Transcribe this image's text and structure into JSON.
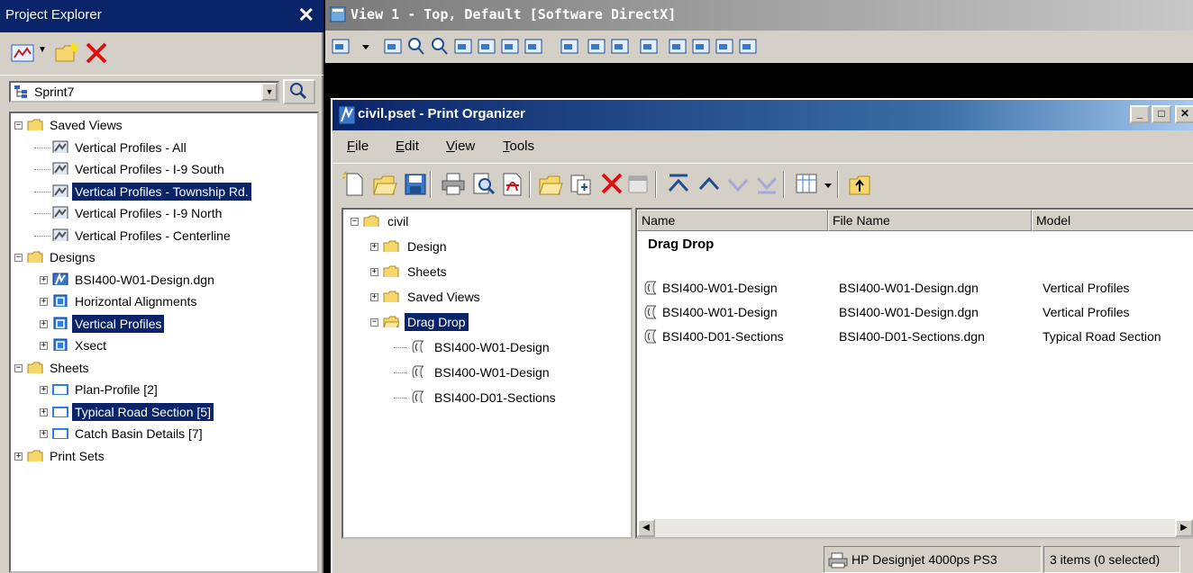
{
  "explorer": {
    "title": "Project Explorer",
    "close_glyph": "✕",
    "combo_value": "Sprint7",
    "tree": [
      {
        "label": "Saved Views",
        "icon": "folder-icon",
        "toggle": "−"
      },
      {
        "label": "Vertical Profiles - All",
        "icon": "saved-view-icon"
      },
      {
        "label": "Vertical Profiles - I-9 South",
        "icon": "saved-view-icon"
      },
      {
        "label": "Vertical Profiles - Township Rd.",
        "icon": "saved-view-icon",
        "selected": true
      },
      {
        "label": "Vertical Profiles - I-9 North",
        "icon": "saved-view-icon"
      },
      {
        "label": "Vertical Profiles - Centerline",
        "icon": "saved-view-icon"
      },
      {
        "label": "Designs",
        "icon": "folder-icon",
        "toggle": "−"
      },
      {
        "label": "BSI400-W01-Design.dgn",
        "icon": "design-file-icon",
        "toggle": "+"
      },
      {
        "label": "Horizontal Alignments",
        "icon": "model-icon",
        "toggle": "+"
      },
      {
        "label": "Vertical Profiles",
        "icon": "model-icon",
        "toggle": "+",
        "selected": true
      },
      {
        "label": "Xsect",
        "icon": "model-icon",
        "toggle": "+"
      },
      {
        "label": "Sheets",
        "icon": "folder-icon",
        "toggle": "−"
      },
      {
        "label": "Plan-Profile [2]",
        "icon": "sheet-icon",
        "toggle": "+"
      },
      {
        "label": "Typical Road Section [5]",
        "icon": "sheet-icon",
        "toggle": "+",
        "selected": true
      },
      {
        "label": "Catch Basin Details [7]",
        "icon": "sheet-icon",
        "toggle": "+"
      },
      {
        "label": "Print Sets",
        "icon": "folder-icon",
        "toggle": "+"
      }
    ]
  },
  "view": {
    "title": "View 1 - Top, Default [Software DirectX]"
  },
  "print_organizer": {
    "title": "civil.pset - Print Organizer",
    "controls": [
      "_",
      "□",
      "✕"
    ],
    "menu": [
      {
        "accel": "F",
        "rest": "ile"
      },
      {
        "accel": "E",
        "rest": "dit"
      },
      {
        "accel": "V",
        "rest": "iew"
      },
      {
        "accel": "T",
        "rest": "ools"
      }
    ],
    "tree": {
      "root": "civil",
      "folders": [
        "Design",
        "Sheets",
        "Saved Views",
        "Drag Drop"
      ],
      "items": [
        "BSI400-W01-Design",
        "BSI400-W01-Design",
        "BSI400-D01-Sections"
      ]
    },
    "list": {
      "columns": [
        "Name",
        "File Name",
        "Model"
      ],
      "group": "Drag Drop",
      "rows": [
        {
          "name": "BSI400-W01-Design",
          "file": "BSI400-W01-Design.dgn",
          "model": "Vertical Profiles"
        },
        {
          "name": "BSI400-W01-Design",
          "file": "BSI400-W01-Design.dgn",
          "model": "Vertical Profiles"
        },
        {
          "name": "BSI400-D01-Sections",
          "file": "BSI400-D01-Sections.dgn",
          "model": "Typical Road Section"
        }
      ]
    },
    "status": {
      "printer": "HP Designjet 4000ps PS3",
      "count": "3 items (0 selected)"
    }
  },
  "colors": {
    "active_title": "#0a246a",
    "selection": "#0a246a",
    "inactive_title": "#7a7a7a",
    "face": "#d4d0c8",
    "folder": "#f5d76e",
    "delete_red": "#e01010"
  }
}
